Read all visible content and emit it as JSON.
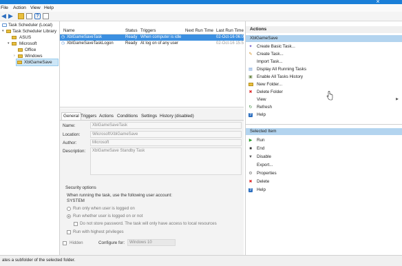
{
  "menubar": {
    "items": [
      "File",
      "Action",
      "View",
      "Help"
    ]
  },
  "tree": {
    "items": [
      {
        "label": "Task Scheduler (Local)",
        "level": 0,
        "icon": "clock-icon",
        "expander": ""
      },
      {
        "label": "Task Scheduler Library",
        "level": 1,
        "icon": "folder-icon",
        "expander": "▾"
      },
      {
        "label": "ASUS",
        "level": 2,
        "icon": "folder-icon",
        "expander": ""
      },
      {
        "label": "Microsoft",
        "level": 2,
        "icon": "folder-icon",
        "expander": "▾"
      },
      {
        "label": "Office",
        "level": 3,
        "icon": "folder-icon",
        "expander": ""
      },
      {
        "label": "Windows",
        "level": 3,
        "icon": "folder-icon",
        "expander": "›"
      },
      {
        "label": "XblGameSave",
        "level": 3,
        "icon": "folder-icon",
        "expander": "",
        "selected": true
      }
    ]
  },
  "tasklist": {
    "columns": [
      "Name",
      "Status",
      "Triggers",
      "Next Run Time",
      "Last Run Time"
    ],
    "rows": [
      {
        "name": "XblGameSaveTask",
        "status": "Ready",
        "triggers": "When computer is idle",
        "next": "",
        "last": "02-Oct-16 06:0",
        "selected": true
      },
      {
        "name": "XblGameSaveTaskLogon",
        "status": "Ready",
        "triggers": "At log on of any user",
        "next": "",
        "last": "02-Oct-16 15:5",
        "selected": false
      }
    ]
  },
  "details": {
    "tabs": [
      "General",
      "Triggers",
      "Actions",
      "Conditions",
      "Settings",
      "History (disabled)"
    ],
    "name_label": "Name:",
    "name_value": "XblGameSaveTask",
    "location_label": "Location:",
    "location_value": "\\Microsoft\\XblGameSave",
    "author_label": "Author:",
    "author_value": "Microsoft",
    "description_label": "Description:",
    "description_value": "XblGameSave Standby Task",
    "security_title": "Security options",
    "security_text": "When running the task, use the following user account:",
    "account": "SYSTEM",
    "opt_logged_on": "Run only when user is logged on",
    "opt_whether": "Run whether user is logged on or not",
    "opt_no_password": "Do not store password.  The task will only have access to local resources",
    "opt_highest": "Run with highest privileges",
    "hidden_label": "Hidden",
    "configure_label": "Configure for:",
    "configure_value": "Windows 10"
  },
  "actions": {
    "header": "Actions",
    "folder_selected": "XblGameSave",
    "folder_actions": [
      {
        "label": "Create Basic Task...",
        "icon": "wand-icon"
      },
      {
        "label": "Create Task...",
        "icon": "new-task-icon"
      },
      {
        "label": "Import Task...",
        "icon": ""
      },
      {
        "label": "Display All Running Tasks",
        "icon": "list-icon"
      },
      {
        "label": "Enable All Tasks History",
        "icon": "history-icon"
      },
      {
        "label": "New Folder...",
        "icon": "folder-icon"
      },
      {
        "label": "Delete Folder",
        "icon": "delete-icon"
      },
      {
        "label": "View",
        "icon": ""
      },
      {
        "label": "Refresh",
        "icon": "refresh-icon"
      },
      {
        "label": "Help",
        "icon": "help-icon"
      }
    ],
    "item_header": "Selected Item",
    "item_actions": [
      {
        "label": "Run",
        "icon": "run-icon"
      },
      {
        "label": "End",
        "icon": "end-icon"
      },
      {
        "label": "Disable",
        "icon": "disable-icon"
      },
      {
        "label": "Export...",
        "icon": ""
      },
      {
        "label": "Properties",
        "icon": "properties-icon"
      },
      {
        "label": "Delete",
        "icon": "delete-icon"
      },
      {
        "label": "Help",
        "icon": "help-icon"
      }
    ]
  },
  "status": "ates a subfolder of the selected folder.",
  "colors": {
    "accent": "#1a7fd8",
    "selected_row": "#3b8fe0",
    "pane_selected": "#b3d4ef"
  }
}
